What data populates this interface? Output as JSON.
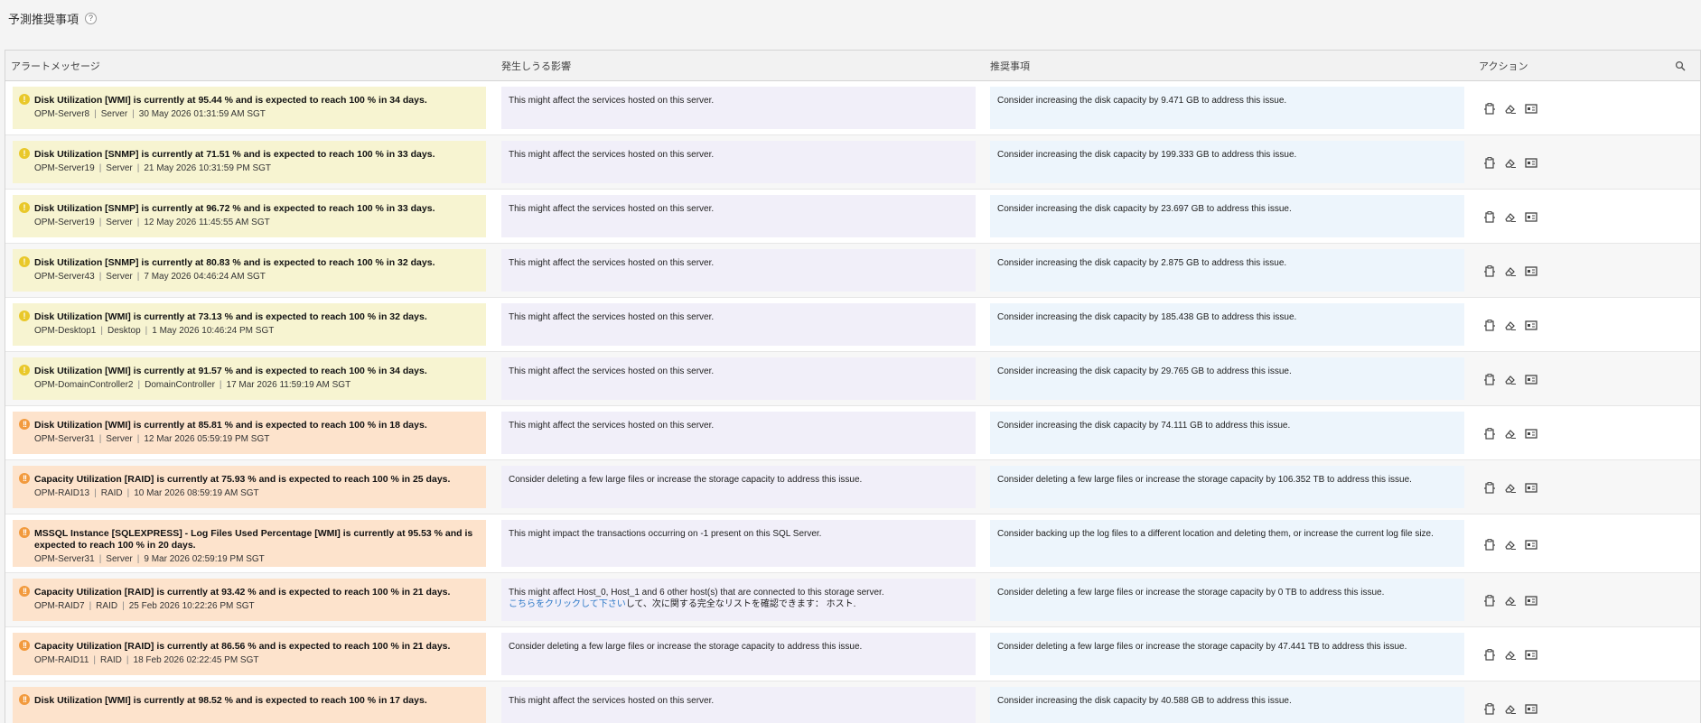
{
  "header": {
    "title": "予測推奨事項",
    "help_glyph": "?"
  },
  "columns": {
    "alert": "アラートメッセージ",
    "impact": "発生しうる影響",
    "recommendation": "推奨事項",
    "action": "アクション"
  },
  "colors": {
    "warning_bg": "#f7f4d1",
    "critical_bg": "#fde3cc",
    "impact_bg": "#f1eff9",
    "recommendation_bg": "#edf5fc",
    "link": "#2f7ac8"
  },
  "rows": [
    {
      "severity": "warning",
      "title": "Disk Utilization [WMI] is currently at 95.44 % and is expected to reach 100 % in 34 days.",
      "device": "OPM-Server8",
      "type": "Server",
      "time": "30 May 2026 01:31:59 AM SGT",
      "impact": "This might affect the services hosted on this server.",
      "recommendation": "Consider increasing the disk capacity by 9.471 GB to address this issue."
    },
    {
      "severity": "warning",
      "title": "Disk Utilization [SNMP] is currently at 71.51 % and is expected to reach 100 % in 33 days.",
      "device": "OPM-Server19",
      "type": "Server",
      "time": "21 May 2026 10:31:59 PM SGT",
      "impact": "This might affect the services hosted on this server.",
      "recommendation": "Consider increasing the disk capacity by 199.333 GB to address this issue."
    },
    {
      "severity": "warning",
      "title": "Disk Utilization [SNMP] is currently at 96.72 % and is expected to reach 100 % in 33 days.",
      "device": "OPM-Server19",
      "type": "Server",
      "time": "12 May 2026 11:45:55 AM SGT",
      "impact": "This might affect the services hosted on this server.",
      "recommendation": "Consider increasing the disk capacity by 23.697 GB to address this issue."
    },
    {
      "severity": "warning",
      "title": "Disk Utilization [SNMP] is currently at 80.83 % and is expected to reach 100 % in 32 days.",
      "device": "OPM-Server43",
      "type": "Server",
      "time": "7 May 2026 04:46:24 AM SGT",
      "impact": "This might affect the services hosted on this server.",
      "recommendation": "Consider increasing the disk capacity by 2.875 GB to address this issue."
    },
    {
      "severity": "warning",
      "title": "Disk Utilization [WMI] is currently at 73.13 % and is expected to reach 100 % in 32 days.",
      "device": "OPM-Desktop1",
      "type": "Desktop",
      "time": "1 May 2026 10:46:24 PM SGT",
      "impact": "This might affect the services hosted on this server.",
      "recommendation": "Consider increasing the disk capacity by 185.438 GB to address this issue."
    },
    {
      "severity": "warning",
      "title": "Disk Utilization [WMI] is currently at 91.57 % and is expected to reach 100 % in 34 days.",
      "device": "OPM-DomainController2",
      "type": "DomainController",
      "time": "17 Mar 2026 11:59:19 AM SGT",
      "impact": "This might affect the services hosted on this server.",
      "recommendation": "Consider increasing the disk capacity by 29.765 GB to address this issue."
    },
    {
      "severity": "critical",
      "title": "Disk Utilization [WMI] is currently at 85.81 % and is expected to reach 100 % in 18 days.",
      "device": "OPM-Server31",
      "type": "Server",
      "time": "12 Mar 2026 05:59:19 PM SGT",
      "impact": "This might affect the services hosted on this server.",
      "recommendation": "Consider increasing the disk capacity by 74.111 GB to address this issue."
    },
    {
      "severity": "critical",
      "title": "Capacity Utilization [RAID] is currently at 75.93 % and is expected to reach 100 % in 25 days.",
      "device": "OPM-RAID13",
      "type": "RAID",
      "time": "10 Mar 2026 08:59:19 AM SGT",
      "impact": "Consider deleting a few large files or increase the storage capacity to address this issue.",
      "recommendation": "Consider deleting a few large files or increase the storage capacity by 106.352 TB to address this issue."
    },
    {
      "severity": "critical",
      "title": "MSSQL Instance [SQLEXPRESS] - Log Files Used Percentage [WMI] is currently at 95.53 % and is expected to reach 100 % in 20 days.",
      "device": "OPM-Server31",
      "type": "Server",
      "time": "9 Mar 2026 02:59:19 PM SGT",
      "impact": "This might impact the transactions occurring on -1 present on this SQL Server.",
      "recommendation": "Consider backing up the log files to a different location and deleting them, or increase the current log file size."
    },
    {
      "severity": "critical",
      "title": "Capacity Utilization [RAID] is currently at 93.42 % and is expected to reach 100 % in 21 days.",
      "device": "OPM-RAID7",
      "type": "RAID",
      "time": "25 Feb 2026 10:22:26 PM SGT",
      "impact": "This might affect Host_0, Host_1 and 6 other host(s) that are connected to this storage server.",
      "impact_link": "こちらをクリックして下さい",
      "impact_link_suffix": "して、次に関する完全なリストを確認できます： ホスト.",
      "recommendation": "Consider deleting a few large files or increase the storage capacity by 0 TB to address this issue."
    },
    {
      "severity": "critical",
      "title": "Capacity Utilization [RAID] is currently at 86.56 % and is expected to reach 100 % in 21 days.",
      "device": "OPM-RAID11",
      "type": "RAID",
      "time": "18 Feb 2026 02:22:45 PM SGT",
      "impact": "Consider deleting a few large files or increase the storage capacity to address this issue.",
      "recommendation": "Consider deleting a few large files or increase the storage capacity by 47.441 TB to address this issue."
    },
    {
      "severity": "critical",
      "title": "Disk Utilization [WMI] is currently at 98.52 % and is expected to reach 100 % in 17 days.",
      "device": "",
      "type": "",
      "time": "",
      "impact": "This might affect the services hosted on this server.",
      "recommendation": "Consider increasing the disk capacity by 40.588 GB to address this issue."
    }
  ],
  "action_icons": [
    "clipboard-icon",
    "eraser-icon",
    "device-snapshot-icon"
  ]
}
